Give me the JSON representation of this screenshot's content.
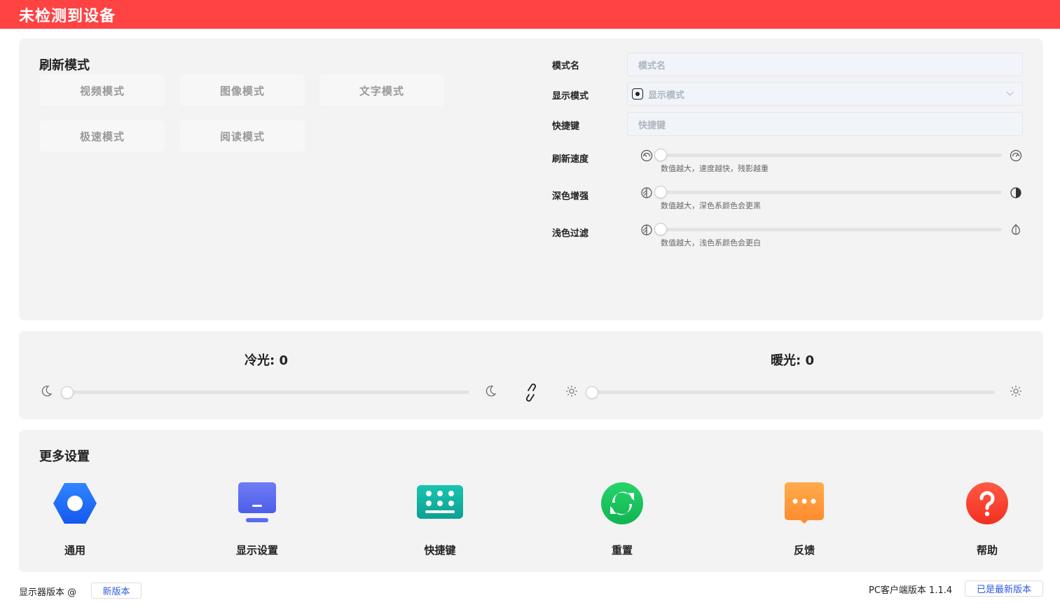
{
  "header": {
    "title": "未检测到设备"
  },
  "refresh": {
    "title": "刷新模式",
    "modes": [
      "视频模式",
      "图像模式",
      "文字模式",
      "极速模式",
      "阅读模式"
    ]
  },
  "form": {
    "mode_name_label": "模式名",
    "mode_name_placeholder": "模式名",
    "display_mode_label": "显示模式",
    "display_mode_value": "显示模式",
    "shortcut_label": "快捷键",
    "shortcut_placeholder": "快捷键",
    "refresh_speed_label": "刷新速度",
    "refresh_speed_hint": "数值越大，速度越快，残影越重",
    "refresh_speed_value": 0,
    "dark_enhance_label": "深色增强",
    "dark_enhance_hint": "数值越大，深色系颜色会更黑",
    "dark_enhance_value": 0,
    "light_filter_label": "浅色过滤",
    "light_filter_hint": "数值越大，浅色系颜色会更白",
    "light_filter_value": 0
  },
  "light": {
    "cold_label": "冷光: 0",
    "warm_label": "暖光: 0",
    "cold_value": 0,
    "warm_value": 0
  },
  "more": {
    "title": "更多设置",
    "tools": [
      {
        "label": "通用",
        "icon": "hexagon-settings-icon",
        "color": "#1f6fff"
      },
      {
        "label": "显示设置",
        "icon": "monitor-icon",
        "color": "#5b6cf0"
      },
      {
        "label": "快捷键",
        "icon": "keyboard-icon",
        "color": "#12b5a6"
      },
      {
        "label": "重置",
        "icon": "refresh-icon",
        "color": "#1ec760"
      },
      {
        "label": "反馈",
        "icon": "chat-bubble-icon",
        "color": "#ff9a3a"
      },
      {
        "label": "帮助",
        "icon": "question-icon",
        "color": "#ff3b30"
      }
    ]
  },
  "footer": {
    "display_version": "显示器版本 @",
    "new_version_btn": "新版本",
    "pc_version": "PC客户端版本 1.1.4",
    "latest_btn": "已是最新版本"
  },
  "colors": {
    "header_bg": "#ff4242",
    "link": "#2d5be3"
  }
}
